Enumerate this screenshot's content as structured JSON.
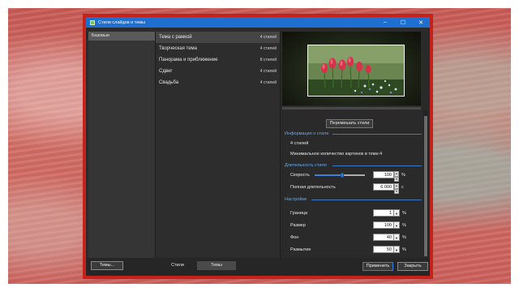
{
  "window": {
    "title": "Стили слайдов и темы"
  },
  "titlebar_buttons": {
    "minimize": "–",
    "maximize": "☐",
    "close": "✕"
  },
  "categories": [
    {
      "label": "Базовые"
    }
  ],
  "themes": [
    {
      "name": "Тема с рамкой",
      "count": "4 стилей"
    },
    {
      "name": "Творческая тема",
      "count": "4 стилей"
    },
    {
      "name": "Панорама и приближение",
      "count": "8 стилей"
    },
    {
      "name": "Сдвиг",
      "count": "4 стилей"
    },
    {
      "name": "Свадьба",
      "count": "4 стилей"
    }
  ],
  "shuffle_button": "Перемешать стили",
  "info": {
    "title": "Информация о стиле",
    "count": "4 стилей",
    "min_pictures": "Минимальное количество картинок в теме:4"
  },
  "duration": {
    "title": "Длительность стиля",
    "speed_label": "Скорость",
    "speed_value": "100",
    "speed_unit": "%",
    "speed_level": 0.55,
    "total_label": "Полная длительность",
    "total_value": "6.000",
    "total_unit": "с"
  },
  "settings": {
    "title": "Настройки",
    "rows": [
      {
        "label": "Граница",
        "value": "1",
        "unit": "%"
      },
      {
        "label": "Размер",
        "value": "100",
        "unit": "%"
      },
      {
        "label": "Фон",
        "value": "40",
        "unit": "%"
      },
      {
        "label": "Размытие",
        "value": "50",
        "unit": "%"
      }
    ]
  },
  "bottom": {
    "themes_button": "Темы...",
    "tab_styles": "Стили",
    "tab_themes": "Темы",
    "apply_button": "Применить",
    "close_button": "Закрыть"
  },
  "colors": {
    "titlebar": "#1f6fd1",
    "window_border": "#c4221b",
    "accent": "#3b82d6",
    "section_title": "#6fa8e8"
  }
}
